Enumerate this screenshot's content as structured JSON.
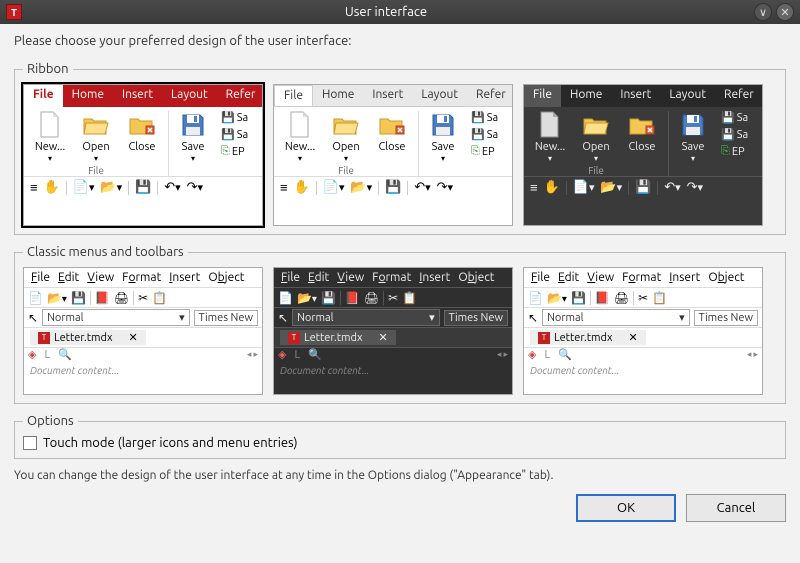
{
  "window": {
    "title": "User interface"
  },
  "intro": "Please choose your preferred design of the user interface:",
  "sections": {
    "ribbon": "Ribbon",
    "classic": "Classic menus and toolbars",
    "options": "Options"
  },
  "ribbon": {
    "tabs": [
      "File",
      "Home",
      "Insert",
      "Layout",
      "Refer"
    ],
    "btn_new": "New...",
    "btn_open": "Open",
    "btn_close": "Close",
    "btn_save": "Save",
    "group_file": "File",
    "side": [
      "Sa",
      "Sa",
      "EP"
    ]
  },
  "classic": {
    "menus": [
      "File",
      "Edit",
      "View",
      "Format",
      "Insert",
      "Object"
    ],
    "style": "Normal",
    "font": "Times New",
    "docname": "Letter.tmdx",
    "footer": "Document content..."
  },
  "options": {
    "touch": "Touch mode (larger icons and menu entries)"
  },
  "hint": "You can change the design of the user interface at any time in the Options dialog (\"Appearance\" tab).",
  "buttons": {
    "ok": "OK",
    "cancel": "Cancel"
  }
}
